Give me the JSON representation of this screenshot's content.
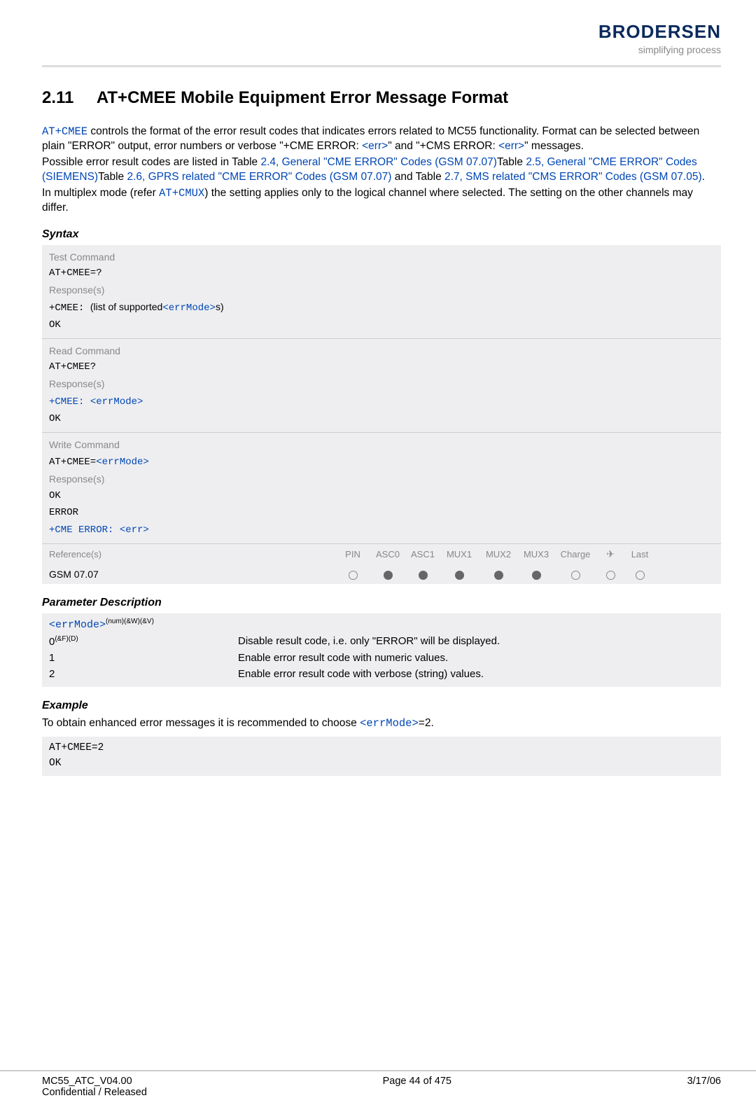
{
  "header": {
    "logo": "BRODERSEN",
    "tagline": "simplifying process"
  },
  "section": {
    "number": "2.11",
    "title": "AT+CMEE   Mobile Equipment Error Message Format"
  },
  "intro": {
    "cmd": "AT+CMEE",
    "t1a": " controls the format of the error result codes that indicates errors related to MC55 functionality. Format can be selected between plain \"ERROR\" output, error numbers or verbose \"+CME ERROR: ",
    "link_err1": "<err>",
    "t1b": "\" and \"+CMS ERROR: ",
    "link_err2": "<err>",
    "t1c": "\" messages.",
    "t2a": "Possible error result codes are listed in Table ",
    "link24": "2.4, General \"CME ERROR\" Codes (GSM 07.07)",
    "t2b": "Table ",
    "link25": "2.5, General \"CME ERROR\" Codes (SIEMENS)",
    "t2c": "Table ",
    "link26": "2.6, GPRS related \"CME ERROR\" Codes (GSM 07.07)",
    "t2d": " and Table ",
    "link27": "2.7, SMS related \"CMS ERROR\" Codes (GSM 07.05)",
    "t2e": ".",
    "t3a": "In multiplex mode (refer ",
    "link_cmux": "AT+CMUX",
    "t3b": ") the setting applies only to the logical channel where selected. The setting on the other channels may differ."
  },
  "syntax": {
    "heading": "Syntax",
    "test_label": "Test Command",
    "test_cmd": "AT+CMEE=?",
    "resp_label": "Response(s)",
    "test_resp_prefix": "+CMEE: ",
    "test_resp_mid": "(list of supported",
    "test_resp_link": "<errMode>",
    "test_resp_suffix": "s)",
    "ok": "OK",
    "read_label": "Read Command",
    "read_cmd": "AT+CMEE?",
    "read_resp_prefix": "+CMEE: ",
    "read_resp_link": "<errMode>",
    "write_label": "Write Command",
    "write_cmd_prefix": "AT+CMEE=",
    "write_cmd_link": "<errMode>",
    "error": "ERROR",
    "cme_prefix": "+CME ERROR: ",
    "cme_link": "<err>",
    "ref_label": "Reference(s)",
    "cols": [
      "PIN",
      "ASC0",
      "ASC1",
      "MUX1",
      "MUX2",
      "MUX3",
      "Charge",
      "✈",
      "Last"
    ],
    "ref_value": "GSM 07.07",
    "dots": [
      "open",
      "fill",
      "fill",
      "fill",
      "fill",
      "fill",
      "open",
      "open",
      "open"
    ]
  },
  "params": {
    "heading": "Parameter Description",
    "name": "<errMode>",
    "sup": "(num)(&W)(&V)",
    "rows": [
      {
        "key_pre": "0",
        "key_sup": "(&F)(D)",
        "desc": "Disable result code, i.e. only \"ERROR\" will be displayed."
      },
      {
        "key_pre": "1",
        "key_sup": "",
        "desc": "Enable error result code with numeric values."
      },
      {
        "key_pre": "2",
        "key_sup": "",
        "desc": "Enable error result code with verbose (string) values."
      }
    ]
  },
  "example": {
    "heading": "Example",
    "intro_a": "To obtain enhanced error messages it is recommended to choose ",
    "intro_link": "<errMode>",
    "intro_b": "=2.",
    "line1": "AT+CMEE=2",
    "line2": "OK"
  },
  "footer": {
    "doc": "MC55_ATC_V04.00",
    "conf": "Confidential / Released",
    "page": "Page 44 of 475",
    "date": "3/17/06"
  }
}
